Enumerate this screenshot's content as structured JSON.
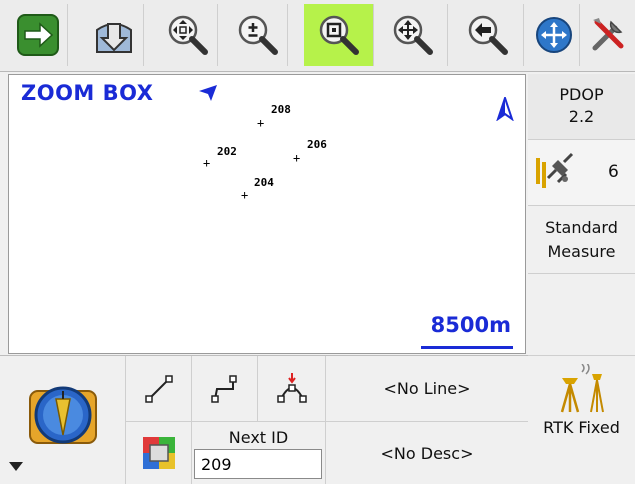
{
  "toolbar": {
    "buttons": [
      {
        "id": "next",
        "icon": "arrow-right-icon",
        "active": false
      },
      {
        "id": "import",
        "icon": "download-icon",
        "active": false
      },
      {
        "id": "zoom-extents",
        "icon": "zoom-extents-icon",
        "active": false
      },
      {
        "id": "zoom-in-out",
        "icon": "zoom-plus-minus-icon",
        "active": false
      },
      {
        "id": "zoom-box",
        "icon": "zoom-box-icon",
        "active": true
      },
      {
        "id": "pan",
        "icon": "pan-icon",
        "active": false
      },
      {
        "id": "back",
        "icon": "zoom-back-icon",
        "active": false
      },
      {
        "id": "globe",
        "icon": "globe-nav-icon",
        "active": false
      },
      {
        "id": "tools",
        "icon": "tools-icon",
        "active": false
      }
    ]
  },
  "map": {
    "mode_label": "ZOOM BOX",
    "points": [
      {
        "label": "208"
      },
      {
        "label": "202"
      },
      {
        "label": "206"
      },
      {
        "label": "204"
      }
    ],
    "scale_label": "8500m",
    "colors": {
      "accent": "#1a2bd6"
    }
  },
  "status": {
    "pdop_label": "PDOP",
    "pdop_value": "2.2",
    "satellite_count": "6",
    "measure_mode_line1": "Standard",
    "measure_mode_line2": "Measure",
    "rtk_status": "RTK Fixed"
  },
  "bottom": {
    "line_value": "<No Line>",
    "desc_value": "<No Desc>",
    "next_id_label": "Next ID",
    "next_id_value": "209"
  }
}
